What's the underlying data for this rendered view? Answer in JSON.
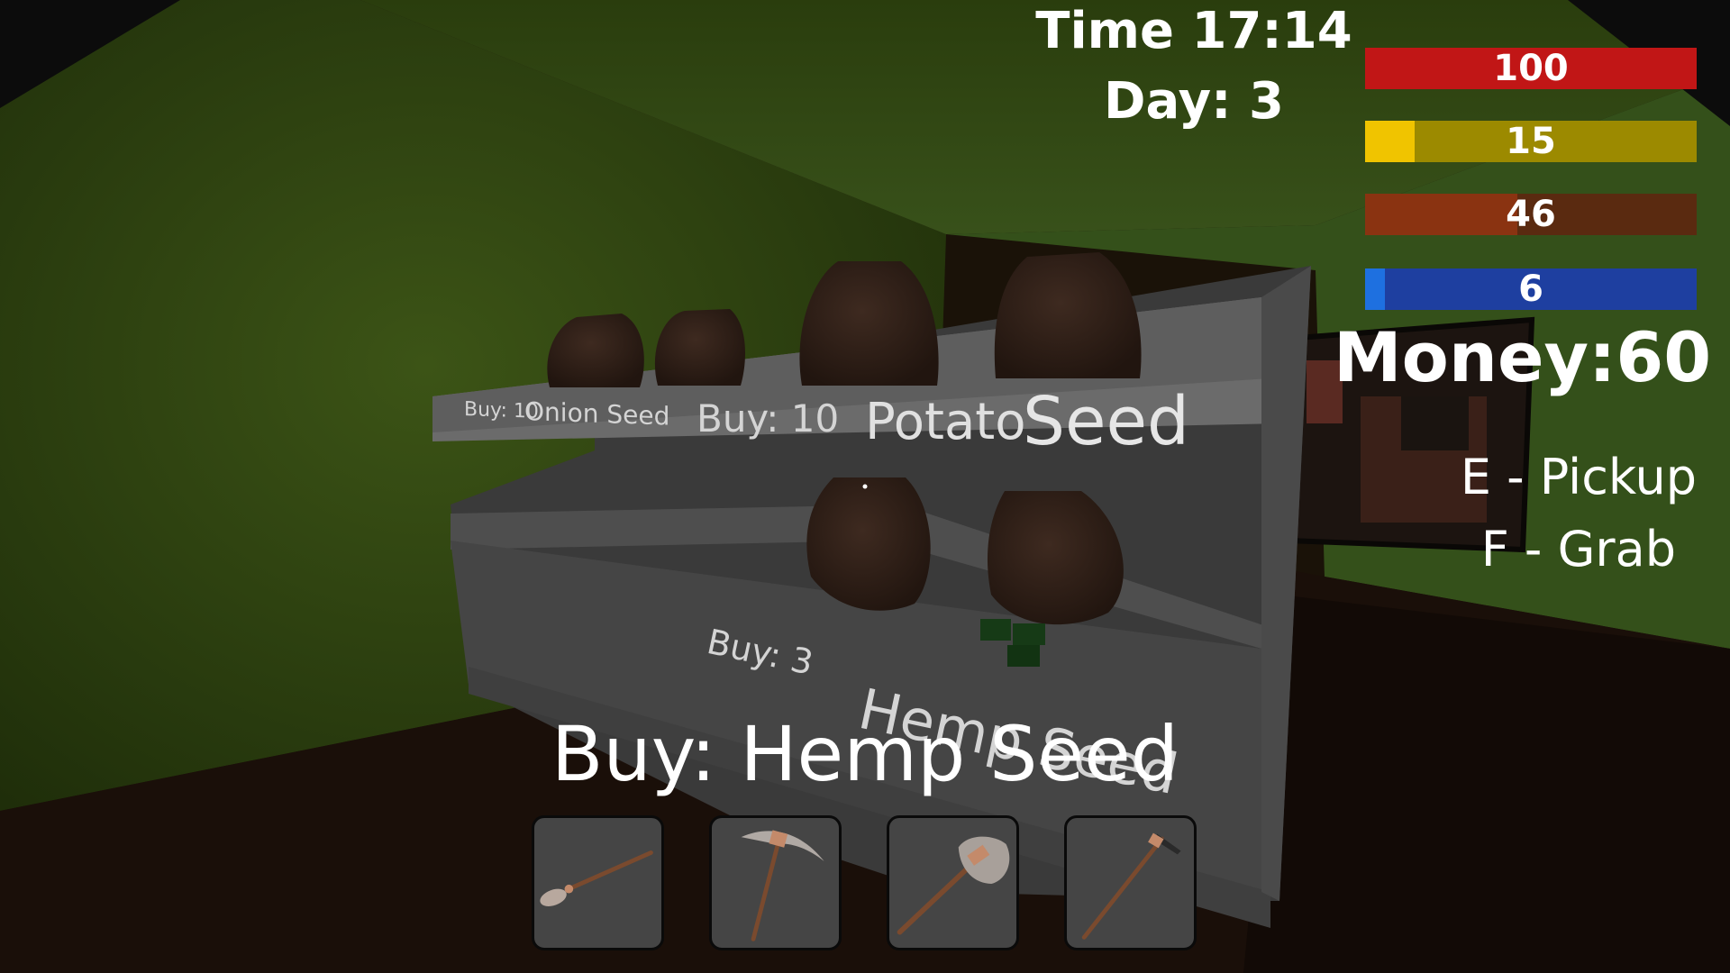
{
  "hud": {
    "time_text": "Time 17:14",
    "day_text": "Day: 3",
    "stats": [
      {
        "name": "health",
        "value": "100",
        "fill": 1.0,
        "color": "#c11616",
        "track": "#c11616"
      },
      {
        "name": "hunger",
        "value": "15",
        "fill": 0.15,
        "color": "#f0c400",
        "track": "#9c8a00"
      },
      {
        "name": "thirst",
        "value": "46",
        "fill": 0.46,
        "color": "#8a3311",
        "track": "#5a2a10"
      },
      {
        "name": "energy",
        "value": "6",
        "fill": 0.06,
        "color": "#1e70e0",
        "track": "#1e3fa0"
      }
    ],
    "money_text": "Money:60",
    "hint_pickup": "E - Pickup",
    "hint_grab": "F - Grab",
    "buy_prompt": "Buy: Hemp Seed"
  },
  "world_labels": {
    "onion_price": "Buy: 10",
    "onion_name": "Onion Seed",
    "potato_price": "Buy: 10",
    "potato_name_1": "Potato",
    "potato_name_2": "Seed",
    "hemp_price": "Buy: 3",
    "hemp_name": "Hemp Seed"
  },
  "hotbar": [
    {
      "item": "shovel-icon"
    },
    {
      "item": "pickaxe-icon"
    },
    {
      "item": "stone-hammer-icon"
    },
    {
      "item": "hoe-icon"
    }
  ]
}
